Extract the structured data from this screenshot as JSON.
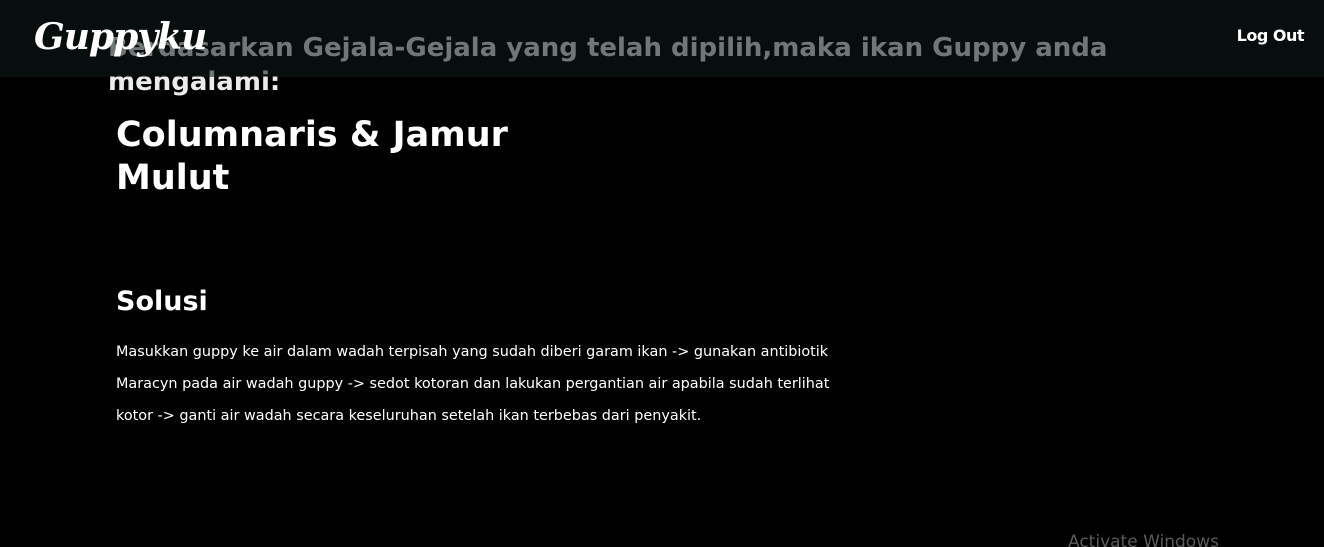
{
  "navbar": {
    "brand": "Guppyku",
    "logout_label": "Log Out"
  },
  "result": {
    "headline": "Berdasarkan Gejala-Gejala yang telah dipilih,maka ikan Guppy anda mengalami:",
    "diagnosis": "Columnaris & Jamur Mulut"
  },
  "solution": {
    "title": "Solusi",
    "text": "Masukkan guppy ke air dalam wadah terpisah yang sudah diberi garam ikan -> gunakan antibiotik Maracyn pada air wadah guppy -> sedot kotoran dan lakukan pergantian air apabila sudah terlihat kotor -> ganti air wadah secara keseluruhan setelah ikan terbebas dari penyakit."
  },
  "os_overlay": {
    "watermark": "Activate Windows"
  },
  "colors": {
    "background": "#000000",
    "navbar": "#0e1818",
    "text": "#ffffff",
    "headline": "#e9eceb"
  }
}
